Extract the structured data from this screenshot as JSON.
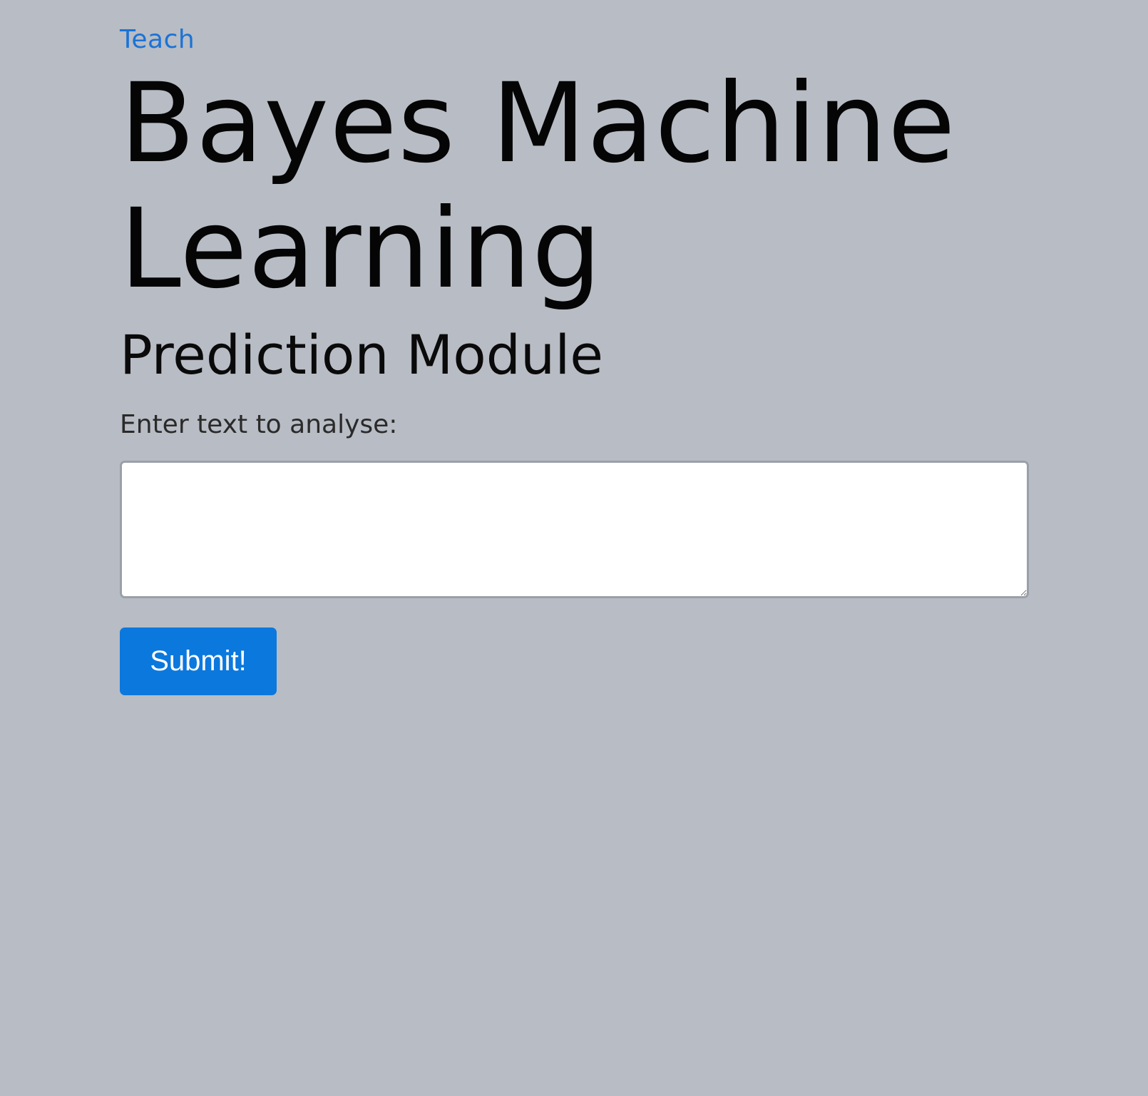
{
  "nav": {
    "teach_link": "Teach"
  },
  "header": {
    "title": "Bayes Machine Learning",
    "subtitle": "Prediction Module"
  },
  "form": {
    "label": "Enter text to analyse:",
    "input_value": "",
    "submit_label": "Submit!"
  },
  "colors": {
    "background": "#b8bcc4",
    "link": "#1a73d6",
    "button": "#0b78de"
  }
}
